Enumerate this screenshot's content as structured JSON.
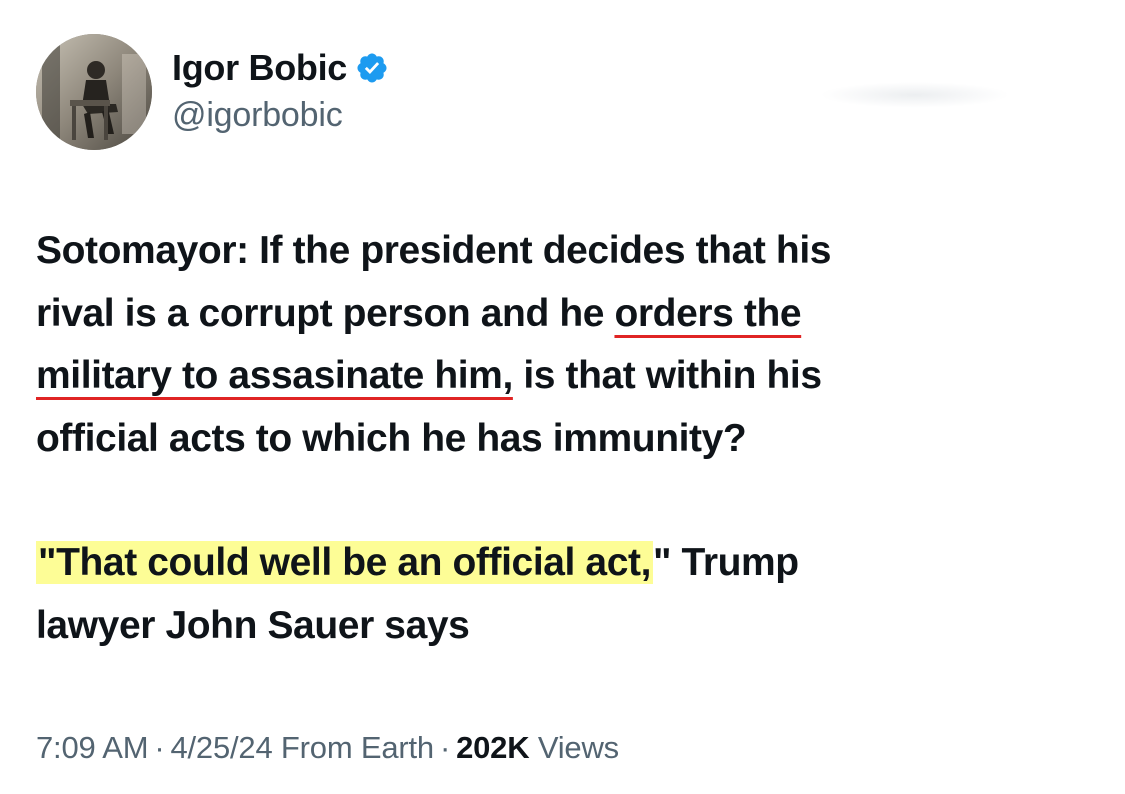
{
  "author": {
    "display_name": "Igor Bobic",
    "handle": "@igorbobic",
    "verified_icon": "verified-badge-icon",
    "verified_color": "#1d9bf0"
  },
  "tweet": {
    "line1": "Sotomayor: If the president decides that his",
    "line2_pre": "rival is a corrupt person and he ",
    "line2_ul": "orders the",
    "line3_ul": "military to assasinate him,",
    "line3_post": " is that within his",
    "line4": "official acts to which he has immunity?",
    "line5_hl": "\"That could well be an official act,",
    "line5_post": "\" Trump",
    "line6": "lawyer John Sauer says"
  },
  "meta": {
    "time": "7:09 AM",
    "sep1": "·",
    "date": "4/25/24",
    "source": "From Earth",
    "sep2": "·",
    "views_count": "202K",
    "views_label": "Views"
  },
  "colors": {
    "underline": "#e02424",
    "highlight": "#fdfd96",
    "secondary_text": "#536471"
  }
}
